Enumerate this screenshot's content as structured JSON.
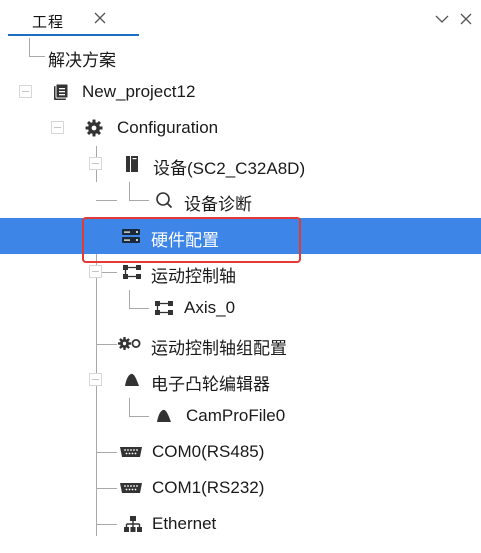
{
  "panel": {
    "tab_label": "工程",
    "tab_close_icon": "close-icon",
    "menu_icon": "chevron-down-icon",
    "close_icon": "close-icon"
  },
  "tree": {
    "solution_label": "解决方案",
    "items": [
      {
        "label": "New_project12",
        "icon": "project-file-icon",
        "toggle": "expanded"
      },
      {
        "label": "Configuration",
        "icon": "gear-icon",
        "toggle": "expanded"
      },
      {
        "label": "设备(SC2_C32A8D)",
        "icon": "device-icon",
        "toggle": "expanded"
      },
      {
        "label": "设备诊断",
        "icon": "magnifier-icon"
      },
      {
        "label": "硬件配置",
        "icon": "hardware-config-icon",
        "selected": true
      },
      {
        "label": "运动控制轴",
        "icon": "motion-axis-icon",
        "toggle": "expanded"
      },
      {
        "label": "Axis_0",
        "icon": "motion-axis-icon"
      },
      {
        "label": "运动控制轴组配置",
        "icon": "gear-pair-icon"
      },
      {
        "label": "电子凸轮编辑器",
        "icon": "cam-icon",
        "toggle": "expanded"
      },
      {
        "label": "CamProFile0",
        "icon": "cam-icon"
      },
      {
        "label": "COM0(RS485)",
        "icon": "serial-port-icon"
      },
      {
        "label": "COM1(RS232)",
        "icon": "serial-port-icon"
      },
      {
        "label": "Ethernet",
        "icon": "network-icon"
      }
    ]
  },
  "colors": {
    "selection": "#3d86e8",
    "highlight_border": "#e53935",
    "tab_underline": "#1b6ec2",
    "icon_dark": "#333333"
  }
}
